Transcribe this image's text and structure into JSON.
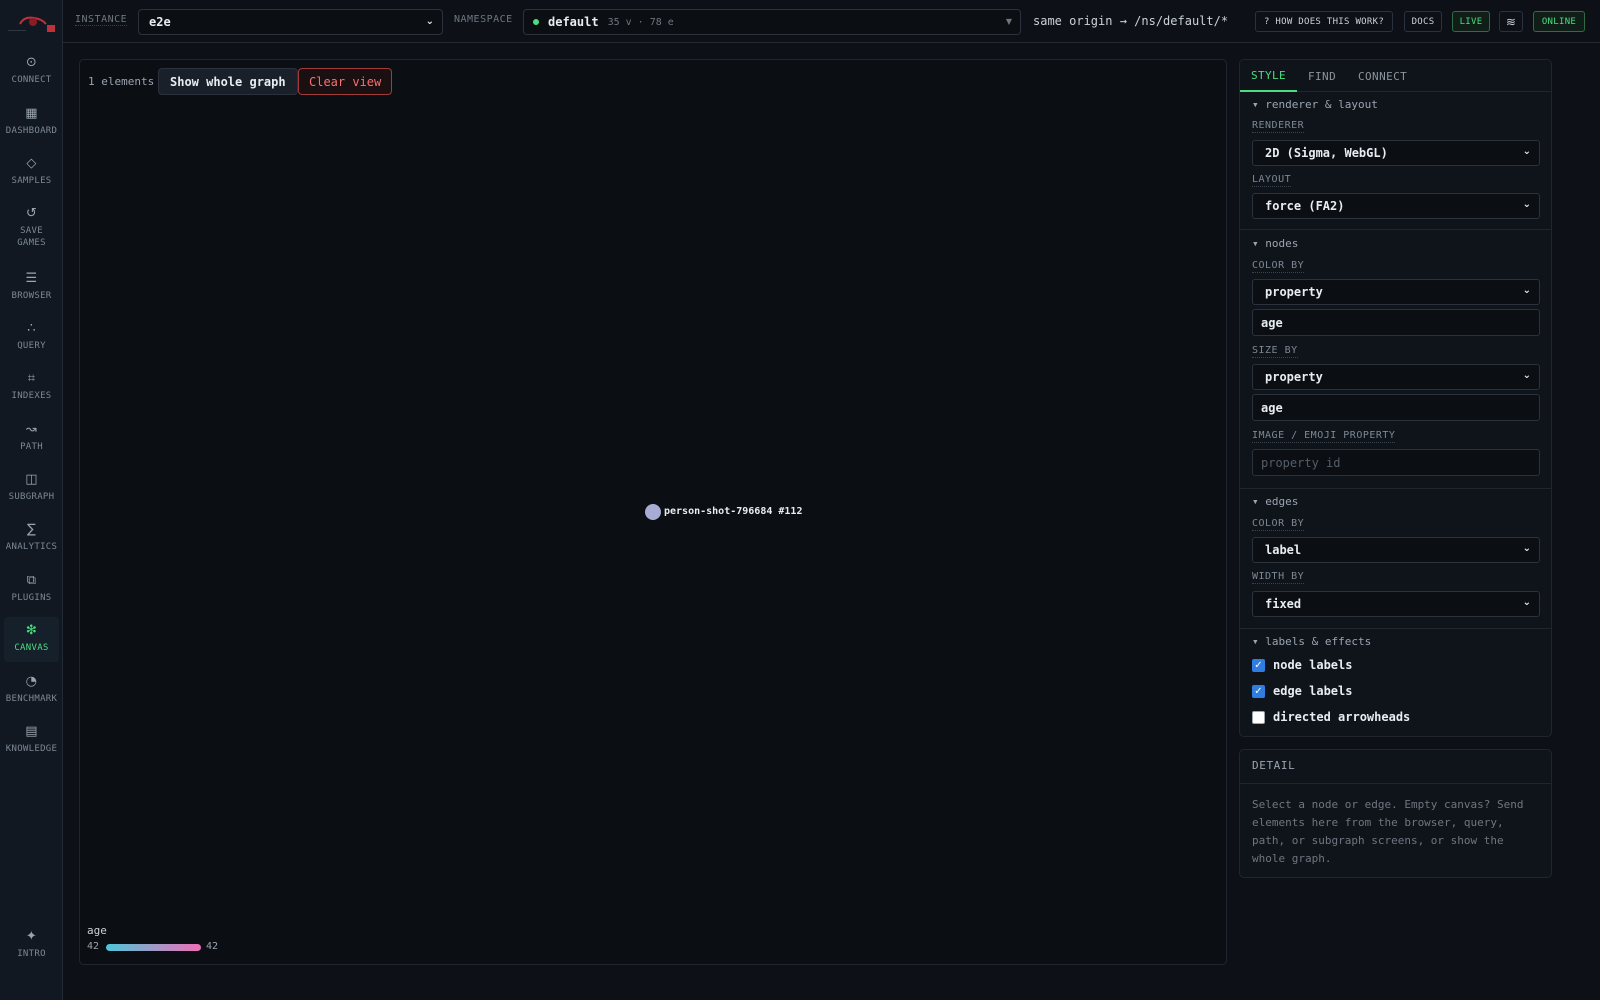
{
  "sidebar": {
    "items": [
      {
        "label": "CONNECT",
        "icon": "⊙",
        "icon_name": "connect-icon"
      },
      {
        "label": "DASHBOARD",
        "icon": "▦",
        "icon_name": "dashboard-icon"
      },
      {
        "label": "SAMPLES",
        "icon": "◇",
        "icon_name": "samples-icon"
      },
      {
        "label": "SAVE GAMES",
        "icon": "↺",
        "icon_name": "save-games-icon"
      },
      {
        "label": "BROWSER",
        "icon": "☰",
        "icon_name": "browser-icon"
      },
      {
        "label": "QUERY",
        "icon": "∴",
        "icon_name": "query-icon"
      },
      {
        "label": "INDEXES",
        "icon": "⌗",
        "icon_name": "indexes-icon"
      },
      {
        "label": "PATH",
        "icon": "↝",
        "icon_name": "path-icon"
      },
      {
        "label": "SUBGRAPH",
        "icon": "◫",
        "icon_name": "subgraph-icon"
      },
      {
        "label": "ANALYTICS",
        "icon": "∑",
        "icon_name": "analytics-icon"
      },
      {
        "label": "PLUGINS",
        "icon": "⧉",
        "icon_name": "plugins-icon"
      },
      {
        "label": "CANVAS",
        "icon": "❇",
        "icon_name": "canvas-icon",
        "active": true
      },
      {
        "label": "BENCHMARK",
        "icon": "◔",
        "icon_name": "benchmark-icon"
      },
      {
        "label": "KNOWLEDGE",
        "icon": "▤",
        "icon_name": "knowledge-icon"
      }
    ],
    "intro": {
      "label": "INTRO",
      "icon": "✦"
    }
  },
  "header": {
    "instance_label": "INSTANCE",
    "instance_value": "e2e",
    "namespace_label": "NAMESPACE",
    "namespace_value": "default",
    "namespace_meta": "35 v · 78 e",
    "origin_text": "same origin → /ns/default/*",
    "help_button": "? HOW DOES THIS WORK?",
    "docs_button": "DOCS",
    "live_button": "LIVE",
    "menu_icon": "≋",
    "online_badge": "ONLINE",
    "status_color": "#4ade80"
  },
  "canvas": {
    "element_count": "1 elements",
    "show_whole_button": "Show whole graph",
    "clear_button": "Clear view",
    "node_label": "person-shot-796684 #112",
    "node_color": "#a8acd4",
    "legend": {
      "title": "age",
      "min": "42",
      "max": "42",
      "gradient_start": "#4cc5d8",
      "gradient_end": "#f06fb5"
    }
  },
  "panel": {
    "tabs": [
      "STYLE",
      "FIND",
      "CONNECT"
    ],
    "active_tab": "STYLE",
    "renderer_section": "▾ renderer & layout",
    "renderer_label": "RENDERER",
    "renderer_value": "2D (Sigma, WebGL)",
    "layout_label": "LAYOUT",
    "layout_value": "force (FA2)",
    "nodes_section": "▾ nodes",
    "node_color_by_label": "COLOR BY",
    "node_color_by_value": "property",
    "node_color_prop": "age",
    "node_size_by_label": "SIZE BY",
    "node_size_by_value": "property",
    "node_size_prop": "age",
    "image_label": "IMAGE / EMOJI PROPERTY",
    "image_placeholder": "property id",
    "edges_section": "▾ edges",
    "edge_color_by_label": "COLOR BY",
    "edge_color_by_value": "label",
    "edge_width_by_label": "WIDTH BY",
    "edge_width_by_value": "fixed",
    "labels_section": "▾ labels & effects",
    "checkboxes": [
      {
        "label": "node labels",
        "checked": true
      },
      {
        "label": "edge labels",
        "checked": true
      },
      {
        "label": "directed arrowheads",
        "checked": false
      }
    ]
  },
  "detail": {
    "title": "DETAIL",
    "text": "Select a node or edge. Empty canvas? Send elements here from the browser, query, path, or subgraph screens, or show the whole graph."
  }
}
